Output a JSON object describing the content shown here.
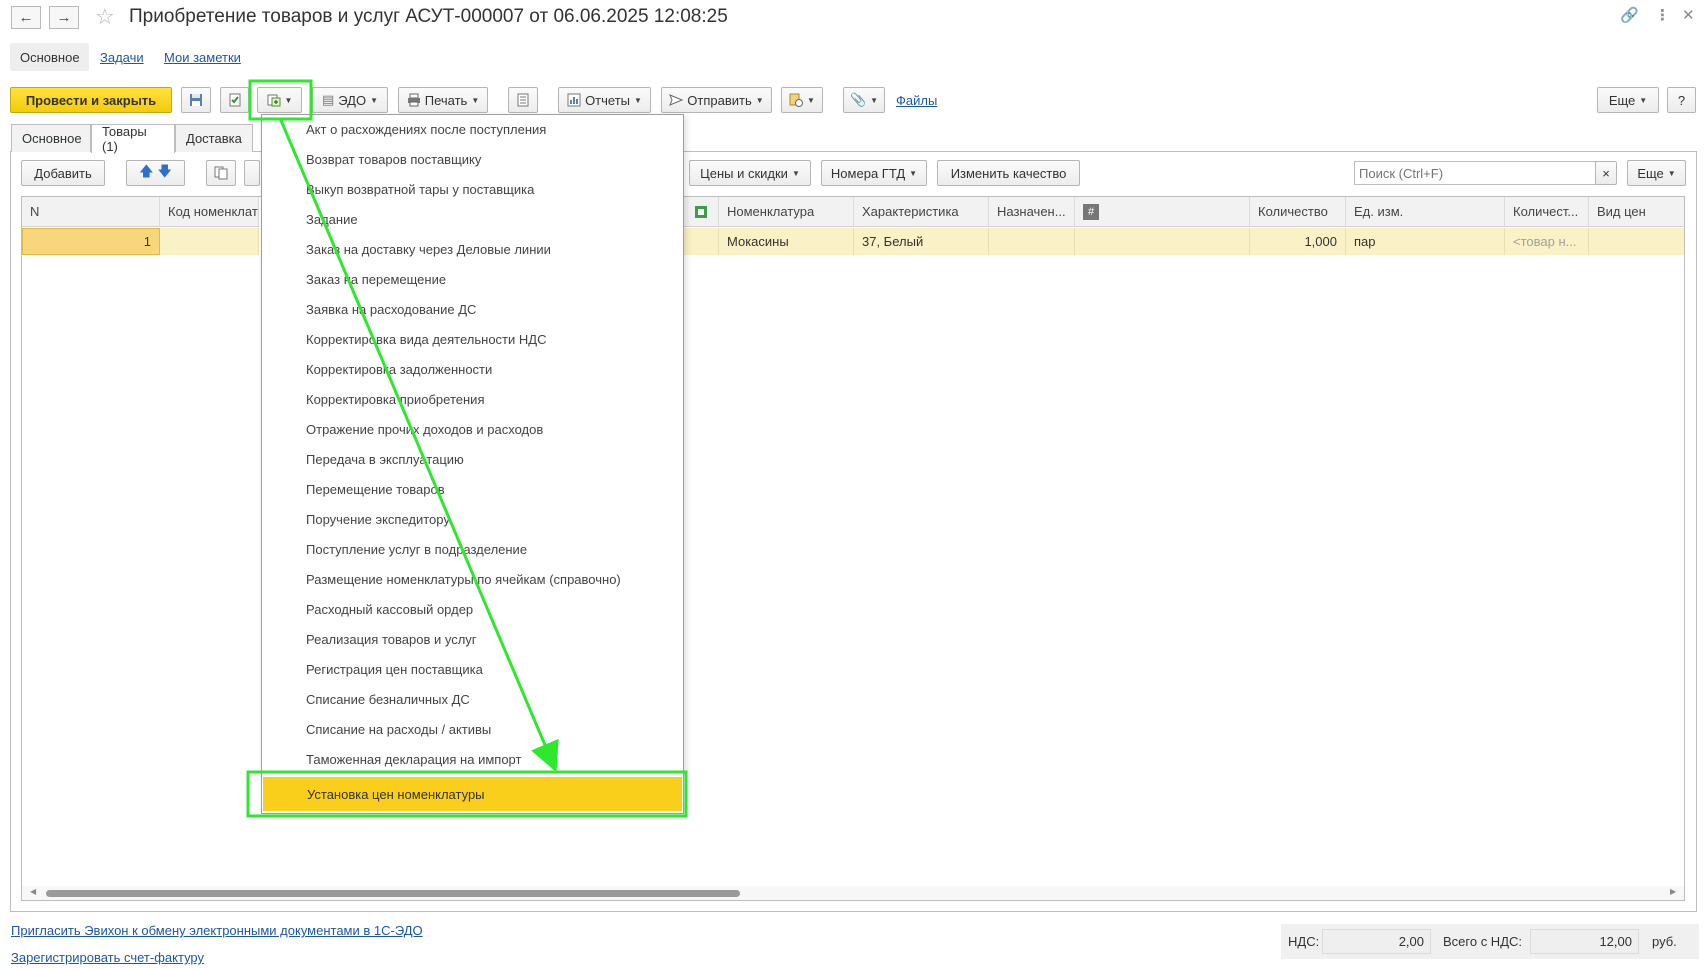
{
  "window": {
    "title": "Приобретение товаров и услуг АСУТ-000007 от 06.06.2025 12:08:25"
  },
  "section_tabs": {
    "main": "Основное",
    "tasks": "Задачи",
    "notes": "Мои заметки"
  },
  "toolbar": {
    "post_close": "Провести и закрыть",
    "edo": "ЭДО",
    "print": "Печать",
    "reports": "Отчеты",
    "send": "Отправить",
    "files": "Файлы",
    "more": "Еще",
    "help": "?"
  },
  "doc_tabs": [
    "Основное",
    "Товары (1)",
    "Доставка"
  ],
  "goods_toolbar": {
    "add": "Добавить",
    "prices": "Цены и скидки",
    "gtd": "Номера ГТД",
    "quality": "Изменить качество",
    "search_placeholder": "Поиск (Ctrl+F)",
    "clear": "×",
    "more": "Еще"
  },
  "table": {
    "headers": {
      "n": "N",
      "code": "Код номенклатуры",
      "nomenclature": "Номенклатура",
      "characteristic": "Характеристика",
      "purpose": "Назначен...",
      "hash": "#",
      "quantity": "Количество",
      "unit": "Ед. изм.",
      "qty2": "Количест...",
      "price_type": "Вид цен"
    },
    "row": {
      "n": "1",
      "nomenclature": "Мокасины",
      "characteristic": "37, Белый",
      "quantity": "1,000",
      "unit": "пар",
      "qty2": "<товар н..."
    }
  },
  "create_menu": {
    "items": [
      "Акт о расхождениях после поступления",
      "Возврат товаров поставщику",
      "Выкуп возвратной тары у поставщика",
      "Задание",
      "Заказ на доставку через Деловые линии",
      "Заказ на перемещение",
      "Заявка на расходование ДС",
      "Корректировка вида деятельности НДС",
      "Корректировка задолженности",
      "Корректировка приобретения",
      "Отражение прочих доходов и расходов",
      "Передача в эксплуатацию",
      "Перемещение товаров",
      "Поручение экспедитору",
      "Поступление услуг в подразделение",
      "Размещение номенклатуры по ячейкам (справочно)",
      "Расходный кассовый ордер",
      "Реализация товаров и услуг",
      "Регистрация цен поставщика",
      "Списание безналичных ДС",
      "Списание на расходы / активы",
      "Таможенная декларация на импорт"
    ],
    "highlighted": "Установка цен номенклатуры"
  },
  "footer": {
    "invite_link": "Пригласить Эвихон к обмену электронными документами в 1С-ЭДО",
    "invoice_link": "Зарегистрировать счет-фактуру",
    "vat_label": "НДС:",
    "vat_value": "2,00",
    "total_label": "Всего с НДС:",
    "total_value": "12,00",
    "currency": "руб."
  },
  "colors": {
    "accent_yellow": "#f9cf1c",
    "annotation_green": "#2ee82e",
    "link_blue": "#1d57a8",
    "row_highlight": "#fbf1c7"
  }
}
